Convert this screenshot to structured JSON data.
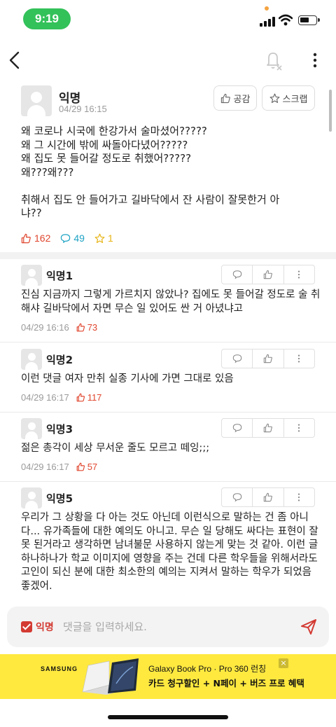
{
  "status_bar": {
    "time": "9:19"
  },
  "post": {
    "author": "익명",
    "date": "04/29 16:15",
    "like_button": "공감",
    "scrap_button": "스크랩",
    "body": "왜 코로나 시국에 한강가서 술마셨어?????\n왜 그 시간에 밖에 싸돌아다녔어?????\n왜 집도 못 들어갈 정도로 취했어?????\n왜???왜???\n\n취해서 집도 안 들어가고 길바닥에서 잔 사람이 잘못한거 아\n냐??",
    "likes": "162",
    "comments": "49",
    "scraps": "1"
  },
  "comments": [
    {
      "author": "익명1",
      "text": "진심 지금까지 그렇게 가르치지 않았나? 집에도 못 들어갈 정도로 술 취해샤 길바닥에서 자면 무슨 일 있어도 싼 거 아녔냐고",
      "date": "04/29 16:16",
      "likes": "73"
    },
    {
      "author": "익명2",
      "text": "이런 댓글 여자 만취 실종 기사에 가면 그대로 있음",
      "date": "04/29 16:17",
      "likes": "117"
    },
    {
      "author": "익명3",
      "text": "젊은 총각이 세상 무서운 줄도 모르고 떼잉;;;",
      "date": "04/29 16:17",
      "likes": "57"
    },
    {
      "author": "익명5",
      "text": "우리가 그 상황을 다 아는 것도 아닌데 이런식으로 말하는 건 좀 아니다... 유가족들에 대한 예의도 아니고. 무슨 일 당해도 싸다는 표현이 잘못 된거라고 생각하면 남녀불문 사용하지 않는게 맞는 것 같아. 이런 글 하나하나가 학교 이미지에 영향을 주는 건데 다른 학우들을 위해서라도 고인이 되신 분에 대한 최소한의 예의는 지켜서 말하는 학우가 되었음 좋겠어."
    }
  ],
  "input_bar": {
    "anon_label": "익명",
    "placeholder": "댓글을 입력하세요."
  },
  "ad": {
    "brand": "SAMSUNG",
    "line1": "Galaxy Book Pro · Pro 360 런칭",
    "line2": "카드 청구할인 + N페이 + 버즈 프로 혜택"
  },
  "colors": {
    "accent_red": "#e0452d",
    "comment_blue": "#1ea3c4",
    "scrap_yellow": "#e7b416",
    "ad_yellow": "#ffe93f",
    "status_green": "#33c15a"
  },
  "icons": [
    "back-arrow-icon",
    "bell-off-icon",
    "more-vertical-icon",
    "thumbs-up-icon",
    "star-icon",
    "speech-bubble-icon",
    "send-icon"
  ]
}
